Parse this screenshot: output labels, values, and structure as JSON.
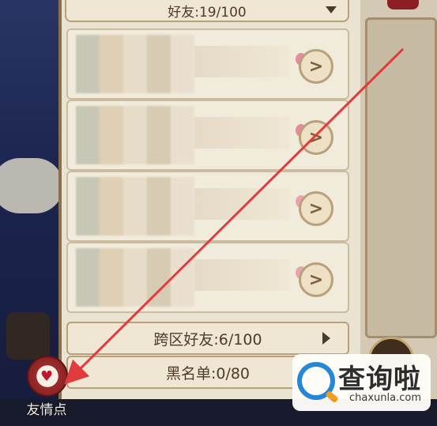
{
  "friends_header": {
    "label": "好友:19/100"
  },
  "friend_rows": [
    {
      "arrow": ">"
    },
    {
      "arrow": ">"
    },
    {
      "arrow": ">"
    },
    {
      "arrow": ">"
    }
  ],
  "cross_server": {
    "label": "跨区好友:6/100"
  },
  "blacklist": {
    "label": "黑名单:0/80"
  },
  "friendship_points": {
    "label": "友情点"
  },
  "watermark": {
    "brand": "查询啦",
    "url": "chaxunla.com"
  },
  "annotation": {
    "color": "#e23b3b"
  }
}
